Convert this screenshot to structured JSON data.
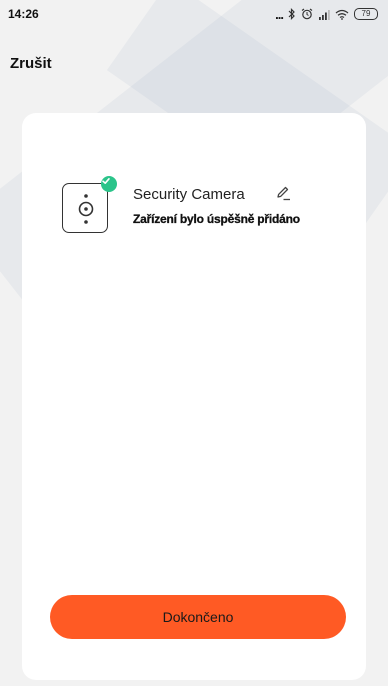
{
  "status_bar": {
    "time": "14:26",
    "dots": "...",
    "battery": "79",
    "icons": [
      "bluetooth-icon",
      "alarm-icon",
      "signal-icon",
      "wifi-icon",
      "battery-icon"
    ]
  },
  "header": {
    "cancel_label": "Zrušit"
  },
  "device": {
    "name": "Security Camera",
    "status": "Zařízení bylo úspěšně přidáno",
    "icon": "camera-icon",
    "badge_icon": "check-icon"
  },
  "actions": {
    "done_label": "Dokončeno"
  },
  "colors": {
    "accent": "#ff5a24",
    "success": "#2bc48a",
    "background": "#f2f2f2",
    "card": "#ffffff"
  }
}
